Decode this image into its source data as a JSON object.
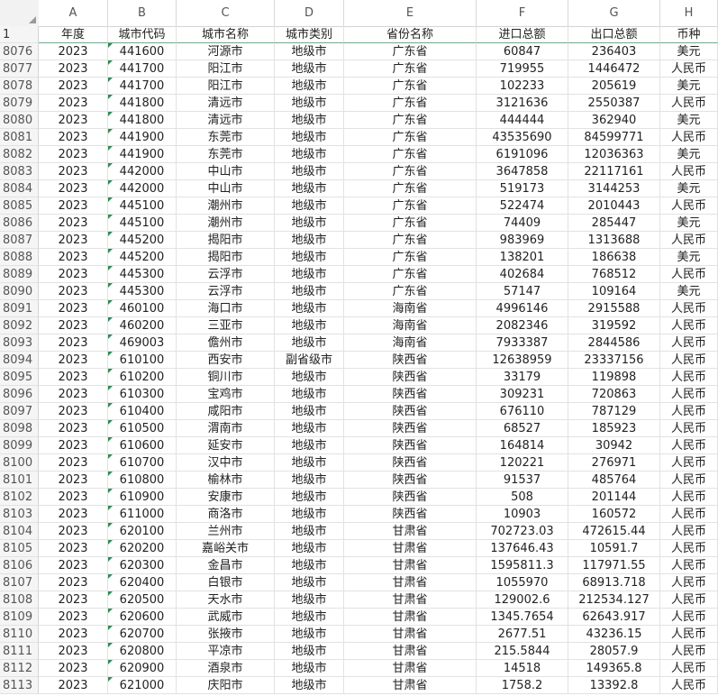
{
  "columns": [
    "A",
    "B",
    "C",
    "D",
    "E",
    "F",
    "G",
    "H"
  ],
  "header_row": {
    "num": "1",
    "cells": [
      "年度",
      "城市代码",
      "城市名称",
      "城市类别",
      "省份名称",
      "进口总额",
      "出口总额",
      "币种"
    ]
  },
  "rows": [
    {
      "num": "8076",
      "cells": [
        "2023",
        "441600",
        "河源市",
        "地级市",
        "广东省",
        "60847",
        "236403",
        "美元"
      ]
    },
    {
      "num": "8077",
      "cells": [
        "2023",
        "441700",
        "阳江市",
        "地级市",
        "广东省",
        "719955",
        "1446472",
        "人民币"
      ]
    },
    {
      "num": "8078",
      "cells": [
        "2023",
        "441700",
        "阳江市",
        "地级市",
        "广东省",
        "102233",
        "205619",
        "美元"
      ]
    },
    {
      "num": "8079",
      "cells": [
        "2023",
        "441800",
        "清远市",
        "地级市",
        "广东省",
        "3121636",
        "2550387",
        "人民币"
      ]
    },
    {
      "num": "8080",
      "cells": [
        "2023",
        "441800",
        "清远市",
        "地级市",
        "广东省",
        "444444",
        "362940",
        "美元"
      ]
    },
    {
      "num": "8081",
      "cells": [
        "2023",
        "441900",
        "东莞市",
        "地级市",
        "广东省",
        "43535690",
        "84599771",
        "人民币"
      ]
    },
    {
      "num": "8082",
      "cells": [
        "2023",
        "441900",
        "东莞市",
        "地级市",
        "广东省",
        "6191096",
        "12036363",
        "美元"
      ]
    },
    {
      "num": "8083",
      "cells": [
        "2023",
        "442000",
        "中山市",
        "地级市",
        "广东省",
        "3647858",
        "22117161",
        "人民币"
      ]
    },
    {
      "num": "8084",
      "cells": [
        "2023",
        "442000",
        "中山市",
        "地级市",
        "广东省",
        "519173",
        "3144253",
        "美元"
      ]
    },
    {
      "num": "8085",
      "cells": [
        "2023",
        "445100",
        "潮州市",
        "地级市",
        "广东省",
        "522474",
        "2010443",
        "人民币"
      ]
    },
    {
      "num": "8086",
      "cells": [
        "2023",
        "445100",
        "潮州市",
        "地级市",
        "广东省",
        "74409",
        "285447",
        "美元"
      ]
    },
    {
      "num": "8087",
      "cells": [
        "2023",
        "445200",
        "揭阳市",
        "地级市",
        "广东省",
        "983969",
        "1313688",
        "人民币"
      ]
    },
    {
      "num": "8088",
      "cells": [
        "2023",
        "445200",
        "揭阳市",
        "地级市",
        "广东省",
        "138201",
        "186638",
        "美元"
      ]
    },
    {
      "num": "8089",
      "cells": [
        "2023",
        "445300",
        "云浮市",
        "地级市",
        "广东省",
        "402684",
        "768512",
        "人民币"
      ]
    },
    {
      "num": "8090",
      "cells": [
        "2023",
        "445300",
        "云浮市",
        "地级市",
        "广东省",
        "57147",
        "109164",
        "美元"
      ]
    },
    {
      "num": "8091",
      "cells": [
        "2023",
        "460100",
        "海口市",
        "地级市",
        "海南省",
        "4996146",
        "2915588",
        "人民币"
      ]
    },
    {
      "num": "8092",
      "cells": [
        "2023",
        "460200",
        "三亚市",
        "地级市",
        "海南省",
        "2082346",
        "319592",
        "人民币"
      ]
    },
    {
      "num": "8093",
      "cells": [
        "2023",
        "469003",
        "儋州市",
        "地级市",
        "海南省",
        "7933387",
        "2844586",
        "人民币"
      ]
    },
    {
      "num": "8094",
      "cells": [
        "2023",
        "610100",
        "西安市",
        "副省级市",
        "陕西省",
        "12638959",
        "23337156",
        "人民币"
      ]
    },
    {
      "num": "8095",
      "cells": [
        "2023",
        "610200",
        "铜川市",
        "地级市",
        "陕西省",
        "33179",
        "119898",
        "人民币"
      ]
    },
    {
      "num": "8096",
      "cells": [
        "2023",
        "610300",
        "宝鸡市",
        "地级市",
        "陕西省",
        "309231",
        "720863",
        "人民币"
      ]
    },
    {
      "num": "8097",
      "cells": [
        "2023",
        "610400",
        "咸阳市",
        "地级市",
        "陕西省",
        "676110",
        "787129",
        "人民币"
      ]
    },
    {
      "num": "8098",
      "cells": [
        "2023",
        "610500",
        "渭南市",
        "地级市",
        "陕西省",
        "68527",
        "185923",
        "人民币"
      ]
    },
    {
      "num": "8099",
      "cells": [
        "2023",
        "610600",
        "延安市",
        "地级市",
        "陕西省",
        "164814",
        "30942",
        "人民币"
      ]
    },
    {
      "num": "8100",
      "cells": [
        "2023",
        "610700",
        "汉中市",
        "地级市",
        "陕西省",
        "120221",
        "276971",
        "人民币"
      ]
    },
    {
      "num": "8101",
      "cells": [
        "2023",
        "610800",
        "榆林市",
        "地级市",
        "陕西省",
        "91537",
        "485764",
        "人民币"
      ]
    },
    {
      "num": "8102",
      "cells": [
        "2023",
        "610900",
        "安康市",
        "地级市",
        "陕西省",
        "508",
        "201144",
        "人民币"
      ]
    },
    {
      "num": "8103",
      "cells": [
        "2023",
        "611000",
        "商洛市",
        "地级市",
        "陕西省",
        "10903",
        "160572",
        "人民币"
      ]
    },
    {
      "num": "8104",
      "cells": [
        "2023",
        "620100",
        "兰州市",
        "地级市",
        "甘肃省",
        "702723.03",
        "472615.44",
        "人民币"
      ]
    },
    {
      "num": "8105",
      "cells": [
        "2023",
        "620200",
        "嘉峪关市",
        "地级市",
        "甘肃省",
        "137646.43",
        "10591.7",
        "人民币"
      ]
    },
    {
      "num": "8106",
      "cells": [
        "2023",
        "620300",
        "金昌市",
        "地级市",
        "甘肃省",
        "1595811.3",
        "117971.55",
        "人民币"
      ]
    },
    {
      "num": "8107",
      "cells": [
        "2023",
        "620400",
        "白银市",
        "地级市",
        "甘肃省",
        "1055970",
        "68913.718",
        "人民币"
      ]
    },
    {
      "num": "8108",
      "cells": [
        "2023",
        "620500",
        "天水市",
        "地级市",
        "甘肃省",
        "129002.6",
        "212534.127",
        "人民币"
      ]
    },
    {
      "num": "8109",
      "cells": [
        "2023",
        "620600",
        "武威市",
        "地级市",
        "甘肃省",
        "1345.7654",
        "62643.917",
        "人民币"
      ]
    },
    {
      "num": "8110",
      "cells": [
        "2023",
        "620700",
        "张掖市",
        "地级市",
        "甘肃省",
        "2677.51",
        "43236.15",
        "人民币"
      ]
    },
    {
      "num": "8111",
      "cells": [
        "2023",
        "620800",
        "平凉市",
        "地级市",
        "甘肃省",
        "215.5844",
        "28057.9",
        "人民币"
      ]
    },
    {
      "num": "8112",
      "cells": [
        "2023",
        "620900",
        "酒泉市",
        "地级市",
        "甘肃省",
        "14518",
        "149365.8",
        "人民币"
      ]
    },
    {
      "num": "8113",
      "cells": [
        "2023",
        "621000",
        "庆阳市",
        "地级市",
        "甘肃省",
        "1758.2",
        "13392.8",
        "人民币"
      ]
    }
  ]
}
